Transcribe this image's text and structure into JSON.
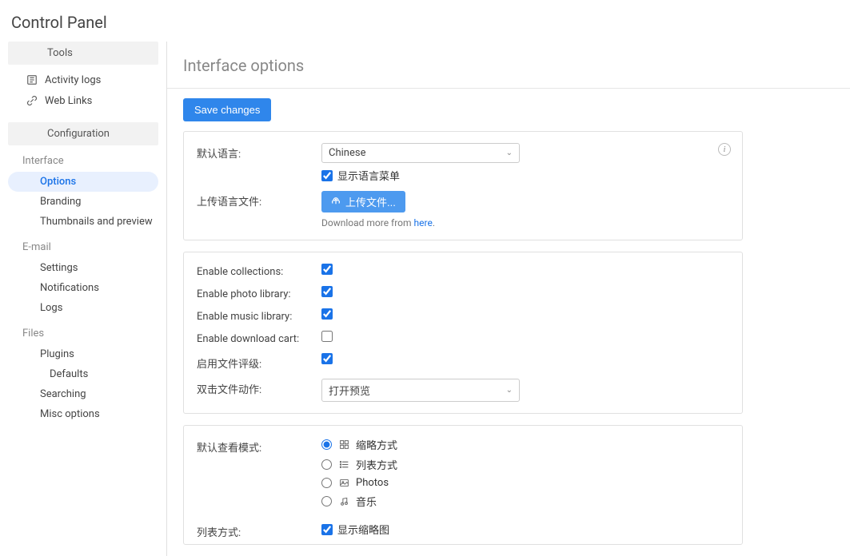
{
  "page_title": "Control Panel",
  "sidebar": {
    "tools_header": "Tools",
    "activity_logs": "Activity logs",
    "web_links": "Web Links",
    "config_header": "Configuration",
    "interface_group": "Interface",
    "options": "Options",
    "branding": "Branding",
    "thumbnails": "Thumbnails and preview",
    "email_group": "E-mail",
    "settings": "Settings",
    "notifications": "Notifications",
    "logs": "Logs",
    "files_group": "Files",
    "plugins": "Plugins",
    "defaults": "Defaults",
    "searching": "Searching",
    "misc": "Misc options"
  },
  "main": {
    "title": "Interface options",
    "save_btn": "Save changes",
    "card1": {
      "default_lang_label": "默认语言:",
      "default_lang_value": "Chinese",
      "show_menu_label": "显示语言菜单",
      "upload_label": "上传语言文件:",
      "upload_btn": "上传文件...",
      "hint_prefix": "Download more from ",
      "hint_link": "here",
      "hint_suffix": "."
    },
    "card2": {
      "enable_collections": "Enable collections:",
      "enable_photo": "Enable photo library:",
      "enable_music": "Enable music library:",
      "enable_cart": "Enable download cart:",
      "enable_rating": "启用文件评级:",
      "dblclick_label": "双击文件动作:",
      "dblclick_value": "打开预览"
    },
    "card3": {
      "view_mode_label": "默认查看模式:",
      "opt_thumb": "缩略方式",
      "opt_list": "列表方式",
      "opt_photos": "Photos",
      "opt_music": "音乐",
      "list_mode_label": "列表方式:",
      "show_thumb_label": "显示缩略图"
    }
  }
}
